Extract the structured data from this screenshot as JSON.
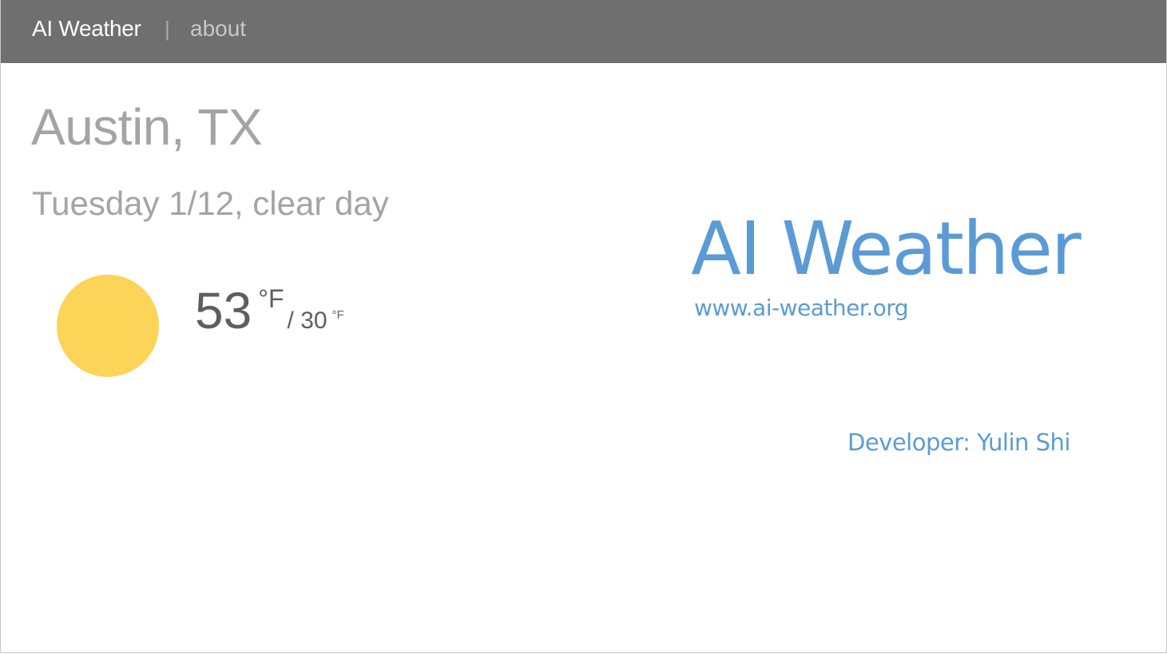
{
  "navbar": {
    "brand": "AI Weather",
    "separator": "|",
    "about_label": "about"
  },
  "weather": {
    "city": "Austin, TX",
    "date_condition": "Tuesday 1/12, clear day",
    "condition_icon": "sun-icon",
    "high": "53",
    "high_unit": "°F",
    "low": "/ 30",
    "low_unit": "°F"
  },
  "branding": {
    "title": "AI Weather",
    "url": "www.ai-weather.org",
    "developer": "Developer: Yulin Shi"
  },
  "colors": {
    "navbar_bg": "#6f6f6f",
    "sun": "#fbd458",
    "brand_blue": "#5b9bd5",
    "muted_text": "#a4a4a4"
  }
}
